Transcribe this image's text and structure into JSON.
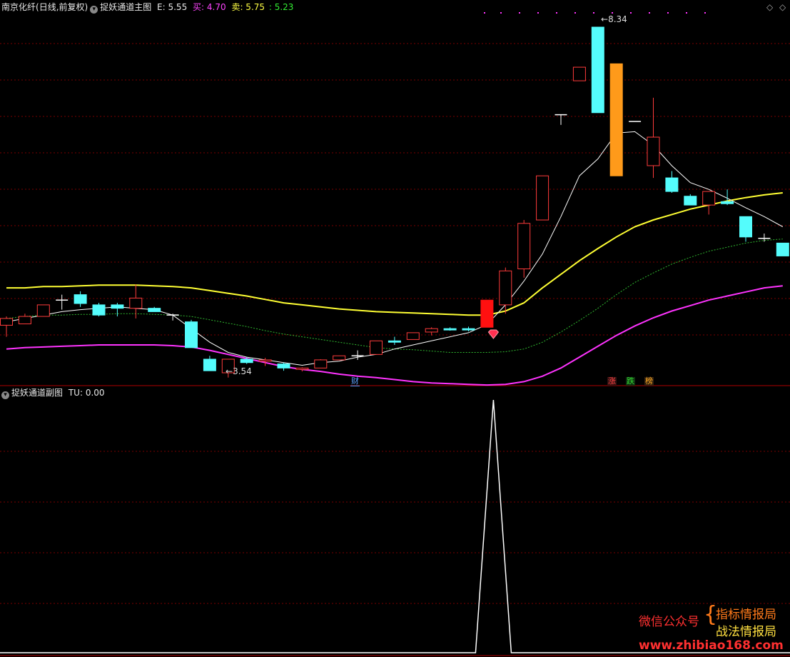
{
  "main_header": {
    "stock": "南京化纤",
    "mode": "(日线,前复权)",
    "indicator": "捉妖通道主图",
    "e_label": "E: 5.55",
    "buy_label": "买: 4.70",
    "sell_label": "卖: 5.75",
    "extra_label": ": 5.23"
  },
  "sub_header": {
    "indicator": "捉妖通道副图",
    "tu_label": "TU: 0.00"
  },
  "badges": {
    "cai": "财",
    "zhang": "涨",
    "die": "跌",
    "bang": "榜"
  },
  "watermark": {
    "left": "微信公众号",
    "top_right": "指标情报局",
    "bottom_right": "战法情报局",
    "url": "www.zhibiao168.com"
  },
  "colors": {
    "up": "#ff3b3b",
    "down": "#54fcfc",
    "upper_band": "#ffff33",
    "lower_band": "#ff33ff",
    "mid_line": "#2fb82f",
    "ma_line": "#ffffff",
    "grid": "#7a0000"
  },
  "chart_data": {
    "type": "candlestick",
    "y_range": [
      3.25,
      8.55
    ],
    "high_label": "8.34",
    "low_label": "3.54",
    "candles": [
      {
        "o": 3.95,
        "h": 4.08,
        "l": 3.78,
        "c": 4.05,
        "color": "up"
      },
      {
        "o": 3.97,
        "h": 4.12,
        "l": 3.97,
        "c": 4.08,
        "color": "up"
      },
      {
        "o": 4.08,
        "h": 4.25,
        "l": 4.08,
        "c": 4.25,
        "color": "up"
      },
      {
        "o": 4.32,
        "h": 4.4,
        "l": 4.18,
        "c": 4.32,
        "color": "flat"
      },
      {
        "o": 4.4,
        "h": 4.45,
        "l": 4.22,
        "c": 4.27,
        "color": "down"
      },
      {
        "o": 4.25,
        "h": 4.28,
        "l": 4.08,
        "c": 4.1,
        "color": "down"
      },
      {
        "o": 4.25,
        "h": 4.28,
        "l": 4.08,
        "c": 4.2,
        "color": "down"
      },
      {
        "o": 4.2,
        "h": 4.55,
        "l": 4.05,
        "c": 4.35,
        "color": "up"
      },
      {
        "o": 4.2,
        "h": 4.22,
        "l": 4.15,
        "c": 4.15,
        "color": "down"
      },
      {
        "o": 4.1,
        "h": 4.12,
        "l": 4.02,
        "c": 4.1,
        "color": "flat"
      },
      {
        "o": 4.0,
        "h": 4.03,
        "l": 3.62,
        "c": 3.62,
        "color": "down"
      },
      {
        "o": 3.45,
        "h": 3.5,
        "l": 3.28,
        "c": 3.28,
        "color": "down"
      },
      {
        "o": 3.25,
        "h": 3.45,
        "l": 3.18,
        "c": 3.45,
        "color": "up"
      },
      {
        "o": 3.45,
        "h": 3.48,
        "l": 3.38,
        "c": 3.4,
        "color": "down"
      },
      {
        "o": 3.42,
        "h": 3.47,
        "l": 3.35,
        "c": 3.44,
        "color": "up"
      },
      {
        "o": 3.38,
        "h": 3.4,
        "l": 3.28,
        "c": 3.32,
        "color": "down"
      },
      {
        "o": 3.3,
        "h": 3.33,
        "l": 3.27,
        "c": 3.32,
        "color": "up"
      },
      {
        "o": 3.32,
        "h": 3.45,
        "l": 3.32,
        "c": 3.44,
        "color": "up"
      },
      {
        "o": 3.44,
        "h": 3.5,
        "l": 3.44,
        "c": 3.5,
        "color": "up"
      },
      {
        "o": 3.5,
        "h": 3.58,
        "l": 3.44,
        "c": 3.5,
        "color": "flat"
      },
      {
        "o": 3.52,
        "h": 3.72,
        "l": 3.52,
        "c": 3.72,
        "color": "up"
      },
      {
        "o": 3.72,
        "h": 3.78,
        "l": 3.66,
        "c": 3.7,
        "color": "down"
      },
      {
        "o": 3.74,
        "h": 3.84,
        "l": 3.74,
        "c": 3.84,
        "color": "up"
      },
      {
        "o": 3.85,
        "h": 3.92,
        "l": 3.8,
        "c": 3.9,
        "color": "up"
      },
      {
        "o": 3.9,
        "h": 3.92,
        "l": 3.87,
        "c": 3.88,
        "color": "down"
      },
      {
        "o": 3.9,
        "h": 3.93,
        "l": 3.86,
        "c": 3.88,
        "color": "down"
      },
      {
        "o": 3.92,
        "h": 4.32,
        "l": 3.92,
        "c": 4.32,
        "color": "solid"
      },
      {
        "o": 4.25,
        "h": 4.8,
        "l": 4.12,
        "c": 4.75,
        "color": "up"
      },
      {
        "o": 4.78,
        "h": 5.5,
        "l": 4.65,
        "c": 5.45,
        "color": "up"
      },
      {
        "o": 5.5,
        "h": 6.15,
        "l": 5.5,
        "c": 6.15,
        "color": "up"
      },
      {
        "o": 7.05,
        "h": 7.05,
        "l": 6.9,
        "c": 7.05,
        "color": "flat"
      },
      {
        "o": 7.55,
        "h": 7.75,
        "l": 7.55,
        "c": 7.75,
        "color": "up"
      },
      {
        "o": 8.34,
        "h": 8.34,
        "l": 7.08,
        "c": 7.08,
        "color": "down"
      },
      {
        "o": 7.8,
        "h": 7.8,
        "l": 6.15,
        "c": 6.15,
        "color": "orange"
      },
      {
        "o": 6.95,
        "h": 6.95,
        "l": 6.95,
        "c": 6.95,
        "color": "flat"
      },
      {
        "o": 6.3,
        "h": 7.3,
        "l": 6.12,
        "c": 6.72,
        "color": "up"
      },
      {
        "o": 6.12,
        "h": 6.22,
        "l": 5.9,
        "c": 5.92,
        "color": "down"
      },
      {
        "o": 5.85,
        "h": 5.88,
        "l": 5.72,
        "c": 5.72,
        "color": "down"
      },
      {
        "o": 5.72,
        "h": 5.92,
        "l": 5.58,
        "c": 5.92,
        "color": "up"
      },
      {
        "o": 5.77,
        "h": 5.95,
        "l": 5.72,
        "c": 5.74,
        "color": "down"
      },
      {
        "o": 5.55,
        "h": 5.55,
        "l": 5.18,
        "c": 5.25,
        "color": "down"
      },
      {
        "o": 5.23,
        "h": 5.3,
        "l": 5.18,
        "c": 5.23,
        "color": "flat"
      },
      {
        "o": 5.16,
        "h": 5.16,
        "l": 4.97,
        "c": 4.97,
        "color": "down"
      }
    ],
    "ma_line": [
      4.0,
      4.05,
      4.1,
      4.15,
      4.18,
      4.2,
      4.22,
      4.2,
      4.18,
      4.1,
      3.9,
      3.7,
      3.55,
      3.48,
      3.44,
      3.4,
      3.36,
      3.4,
      3.42,
      3.48,
      3.52,
      3.6,
      3.66,
      3.72,
      3.78,
      3.84,
      3.96,
      4.25,
      4.6,
      5.0,
      5.55,
      6.15,
      6.4,
      6.78,
      6.8,
      6.6,
      6.3,
      6.05,
      5.95,
      5.82,
      5.68,
      5.55,
      5.4
    ],
    "upper_band": [
      4.5,
      4.5,
      4.52,
      4.52,
      4.53,
      4.54,
      4.54,
      4.54,
      4.53,
      4.52,
      4.5,
      4.46,
      4.42,
      4.38,
      4.33,
      4.28,
      4.25,
      4.22,
      4.19,
      4.17,
      4.15,
      4.14,
      4.13,
      4.12,
      4.11,
      4.1,
      4.1,
      4.16,
      4.28,
      4.5,
      4.7,
      4.9,
      5.08,
      5.25,
      5.4,
      5.5,
      5.58,
      5.66,
      5.72,
      5.78,
      5.83,
      5.87,
      5.9
    ],
    "mid_line": [
      4.05,
      4.08,
      4.1,
      4.1,
      4.11,
      4.11,
      4.12,
      4.12,
      4.11,
      4.1,
      4.08,
      4.03,
      3.98,
      3.93,
      3.87,
      3.82,
      3.78,
      3.74,
      3.7,
      3.66,
      3.62,
      3.6,
      3.59,
      3.57,
      3.55,
      3.55,
      3.55,
      3.56,
      3.6,
      3.7,
      3.85,
      4.02,
      4.2,
      4.4,
      4.58,
      4.72,
      4.85,
      4.95,
      5.04,
      5.1,
      5.16,
      5.2,
      5.22
    ],
    "lower_band": [
      3.6,
      3.62,
      3.63,
      3.64,
      3.65,
      3.66,
      3.66,
      3.66,
      3.66,
      3.65,
      3.63,
      3.58,
      3.52,
      3.46,
      3.4,
      3.34,
      3.3,
      3.27,
      3.23,
      3.2,
      3.18,
      3.15,
      3.12,
      3.1,
      3.09,
      3.08,
      3.07,
      3.08,
      3.12,
      3.2,
      3.32,
      3.48,
      3.64,
      3.8,
      3.94,
      4.06,
      4.16,
      4.24,
      4.32,
      4.38,
      4.44,
      4.5,
      4.53
    ],
    "sub_series_name": "TU",
    "sub_values": [
      0,
      0,
      0,
      0,
      0,
      0,
      0,
      0,
      0,
      0,
      0,
      0,
      0,
      0,
      0,
      0,
      0,
      0,
      0,
      0,
      0,
      0,
      0,
      0,
      0,
      0,
      1,
      0,
      0,
      0,
      0,
      0,
      0,
      0,
      0,
      0,
      0,
      0,
      0,
      0,
      0,
      0,
      0
    ],
    "sub_range": [
      0,
      1
    ]
  }
}
